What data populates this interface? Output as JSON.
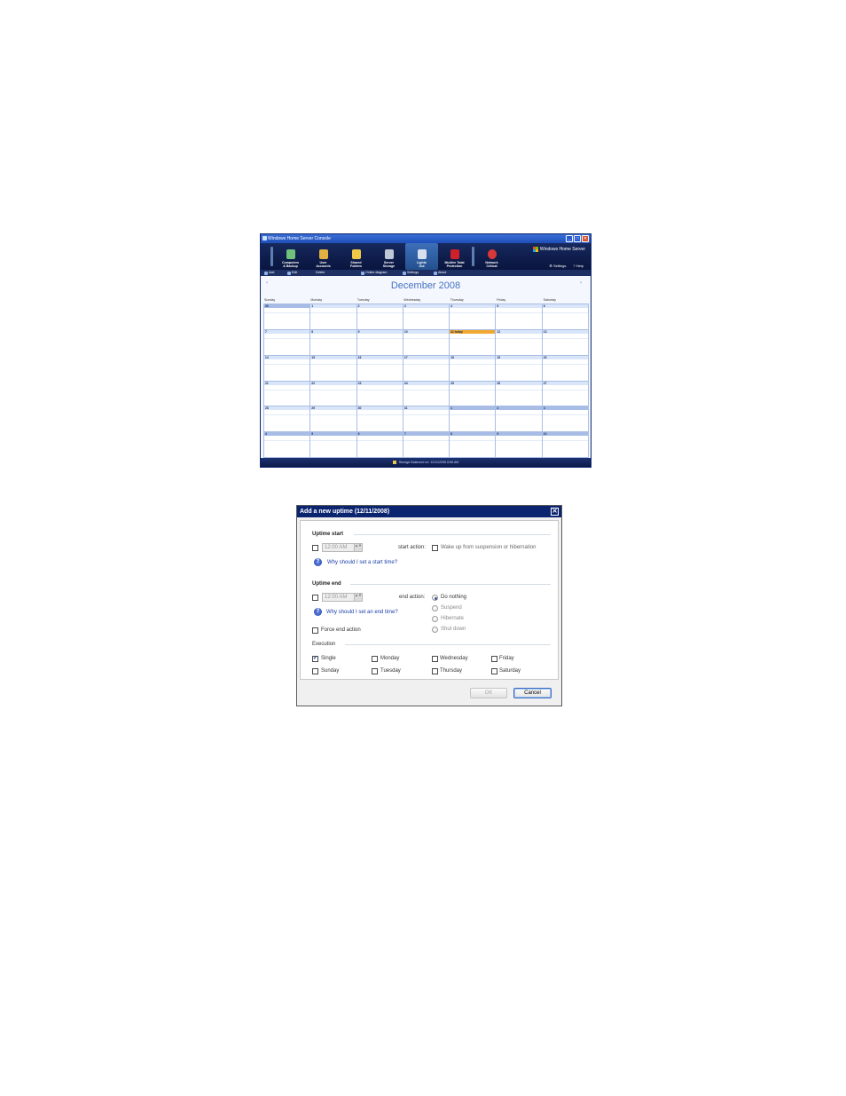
{
  "console": {
    "title": "Windows Home Server Console",
    "window_buttons": [
      "_",
      "□",
      "✕"
    ],
    "tabs": [
      {
        "label_line1": "Computers",
        "label_line2": "& Backup",
        "icon": "computers-icon",
        "color": "#6fc07a"
      },
      {
        "label_line1": "User",
        "label_line2": "Accounts",
        "icon": "users-icon",
        "color": "#e0b040"
      },
      {
        "label_line1": "Shared",
        "label_line2": "Folders",
        "icon": "folder-icon",
        "color": "#f0c848"
      },
      {
        "label_line1": "Server",
        "label_line2": "Storage",
        "icon": "storage-icon",
        "color": "#c0c8d8"
      },
      {
        "label_line1": "Lights",
        "label_line2": "Out",
        "icon": "lights-out-icon",
        "color": "#d8e0f0",
        "active": true
      },
      {
        "label_line1": "McAfee Total",
        "label_line2": "Protection",
        "icon": "mcafee-icon",
        "color": "#d0202a"
      },
      {
        "label_line1": "Network",
        "label_line2": "Critical",
        "icon": "network-critical-icon",
        "color": "#d83838"
      }
    ],
    "brand": "Windows Home Server",
    "links": {
      "settings": "Settings",
      "help": "Help"
    },
    "commands": {
      "add": "Add",
      "edit": "Edit",
      "delete": "Delete",
      "online_diagram": "Online diagram",
      "settings": "Settings",
      "about": "About"
    },
    "calendar": {
      "month_title": "December 2008",
      "prev": "‹",
      "next": "›",
      "weekdays": [
        "Sunday",
        "Monday",
        "Tuesday",
        "Wednesday",
        "Thursday",
        "Friday",
        "Saturday"
      ],
      "weeks": [
        [
          "30",
          "1",
          "2",
          "3",
          "4",
          "5",
          "6"
        ],
        [
          "7",
          "8",
          "9",
          "10",
          "11 today",
          "12",
          "13"
        ],
        [
          "14",
          "15",
          "16",
          "17",
          "18",
          "19",
          "20"
        ],
        [
          "21",
          "22",
          "23",
          "24",
          "25",
          "26",
          "27"
        ],
        [
          "28",
          "29",
          "30",
          "31",
          "1",
          "2",
          "3"
        ],
        [
          "4",
          "5",
          "6",
          "7",
          "8",
          "9",
          "10"
        ]
      ]
    },
    "status": "Storage Balanced on: 12/11/2008 8:56 AM"
  },
  "dialog": {
    "title": "Add a new uptime (12/11/2008)",
    "close": "✕",
    "uptime_start": {
      "heading": "Uptime start",
      "time": "12:00 AM",
      "action_label": "start action:",
      "wake_label": "Wake up from suspension or hibernation",
      "help_link": "Why should I set a start time?"
    },
    "uptime_end": {
      "heading": "Uptime end",
      "time": "12:00 AM",
      "action_label": "end action:",
      "options": [
        "Do nothing",
        "Suspend",
        "Hibernate",
        "Shut down"
      ],
      "help_link": "Why should I set an end time?",
      "force_label": "Force end action"
    },
    "execution": {
      "heading": "Execution",
      "options": [
        "Single",
        "Monday",
        "Wednesday",
        "Friday",
        "Sunday",
        "Tuesday",
        "Thursday",
        "Saturday"
      ],
      "checked": "✔"
    },
    "buttons": {
      "ok": "OK",
      "cancel": "Cancel"
    },
    "help_glyph": "?",
    "spin_glyph": "▲▼"
  }
}
